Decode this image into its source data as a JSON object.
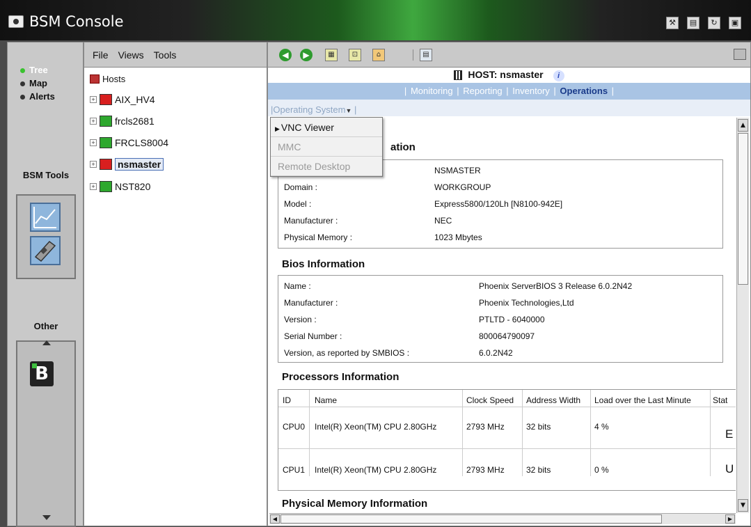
{
  "window": {
    "title": "BSM Console",
    "title_icons": [
      "tools-icon",
      "document-icon",
      "refresh-icon",
      "monitor-icon"
    ]
  },
  "leftnav": {
    "items": [
      {
        "label": "Tree",
        "active": true
      },
      {
        "label": "Map",
        "active": false
      },
      {
        "label": "Alerts",
        "active": false
      }
    ],
    "bsm_tools_label": "BSM Tools",
    "other_label": "Other",
    "other_icon_letter": "B"
  },
  "treepane": {
    "menu": [
      "File",
      "Views",
      "Tools"
    ],
    "root": "Hosts",
    "nodes": [
      {
        "label": "AIX_HV4",
        "icon_color": "#d81f1f"
      },
      {
        "label": "frcls2681",
        "icon_color": "#2ea82e"
      },
      {
        "label": "FRCLS8004",
        "icon_color": "#2ea82e"
      },
      {
        "label": "nsmaster",
        "icon_color": "#d81f1f",
        "selected": true
      },
      {
        "label": "NST820",
        "icon_color": "#2ea82e"
      }
    ]
  },
  "host": {
    "title": "HOST: nsmaster",
    "info_icon": "i"
  },
  "tabs": {
    "items": [
      {
        "label": "Monitoring",
        "active": false
      },
      {
        "label": "Reporting",
        "active": false
      },
      {
        "label": "Inventory",
        "active": false
      },
      {
        "label": "Operations",
        "active": true
      }
    ]
  },
  "subtab": {
    "label": "Operating System",
    "separator": "|"
  },
  "dropdown": {
    "items": [
      {
        "label": "VNC Viewer",
        "enabled": true
      },
      {
        "label": "MMC",
        "enabled": false
      },
      {
        "label": "Remote Desktop",
        "enabled": false
      }
    ]
  },
  "system_info": {
    "heading_visible": "ation",
    "rows": [
      {
        "key": "",
        "value": "NSMASTER"
      },
      {
        "key": "Domain :",
        "value": "WORKGROUP"
      },
      {
        "key": "Model :",
        "value": "Express5800/120Lh [N8100-942E]"
      },
      {
        "key": "Manufacturer :",
        "value": "NEC"
      },
      {
        "key": "Physical Memory :",
        "value": "1023 Mbytes"
      }
    ]
  },
  "bios_info": {
    "heading": "Bios Information",
    "rows": [
      {
        "key": "Name :",
        "value": "Phoenix ServerBIOS 3 Release 6.0.2N42"
      },
      {
        "key": "Manufacturer :",
        "value": "Phoenix Technologies,Ltd"
      },
      {
        "key": "Version :",
        "value": "PTLTD - 6040000"
      },
      {
        "key": "Serial Number :",
        "value": "800064790097"
      },
      {
        "key": "Version, as reported by SMBIOS :",
        "value": "6.0.2N42"
      }
    ]
  },
  "processors": {
    "heading": "Processors Information",
    "columns": [
      "ID",
      "Name",
      "Clock Speed",
      "Address Width",
      "Load over the Last Minute",
      "Stat"
    ],
    "rows": [
      {
        "id": "CPU0",
        "name": "Intel(R) Xeon(TM) CPU 2.80GHz",
        "clock": "2793 MHz",
        "width": "32 bits",
        "load": "4 %",
        "status": "E"
      },
      {
        "id": "CPU1",
        "name": "Intel(R) Xeon(TM) CPU 2.80GHz",
        "clock": "2793 MHz",
        "width": "32 bits",
        "load": "0 %",
        "status": "U"
      }
    ]
  },
  "memory": {
    "heading": "Physical Memory Information"
  }
}
